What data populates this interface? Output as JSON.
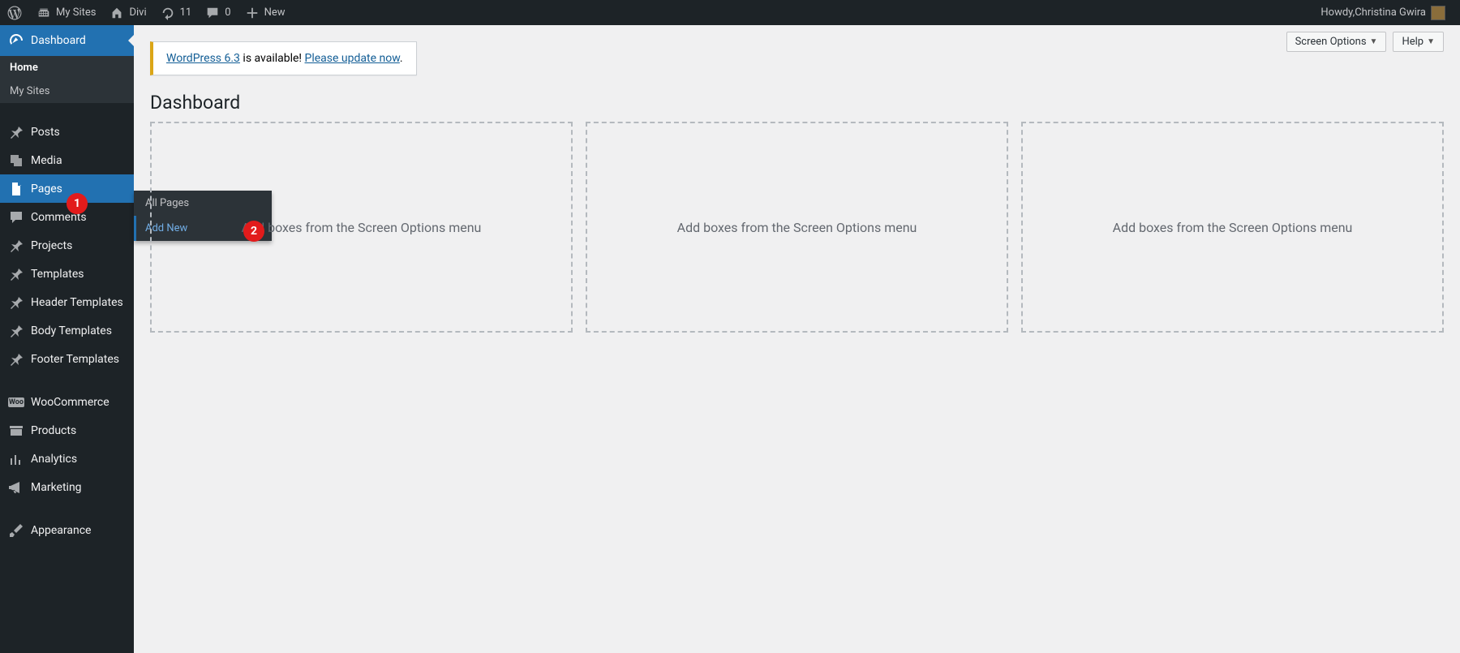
{
  "adminbar": {
    "my_sites": "My Sites",
    "site_name": "Divi",
    "updates_count": "11",
    "comments_count": "0",
    "new_label": "New",
    "howdy_prefix": "Howdy, ",
    "user_name": "Christina Gwira"
  },
  "sidemenu": {
    "dashboard": "Dashboard",
    "dashboard_sub": {
      "home": "Home",
      "my_sites": "My Sites"
    },
    "posts": "Posts",
    "media": "Media",
    "pages": "Pages",
    "comments": "Comments",
    "projects": "Projects",
    "templates": "Templates",
    "header_templates": "Header Templates",
    "body_templates": "Body Templates",
    "footer_templates": "Footer Templates",
    "woocommerce": "WooCommerce",
    "products": "Products",
    "analytics": "Analytics",
    "marketing": "Marketing",
    "appearance": "Appearance"
  },
  "pages_flyout": {
    "all_pages": "All Pages",
    "add_new": "Add New"
  },
  "badges": {
    "one": "1",
    "two": "2"
  },
  "top_buttons": {
    "screen_options": "Screen Options",
    "help": "Help"
  },
  "notice": {
    "link1": "WordPress 6.3",
    "mid": " is available! ",
    "link2": "Please update now",
    "tail": "."
  },
  "page_title": "Dashboard",
  "dash_placeholder": "Add boxes from the Screen Options menu"
}
